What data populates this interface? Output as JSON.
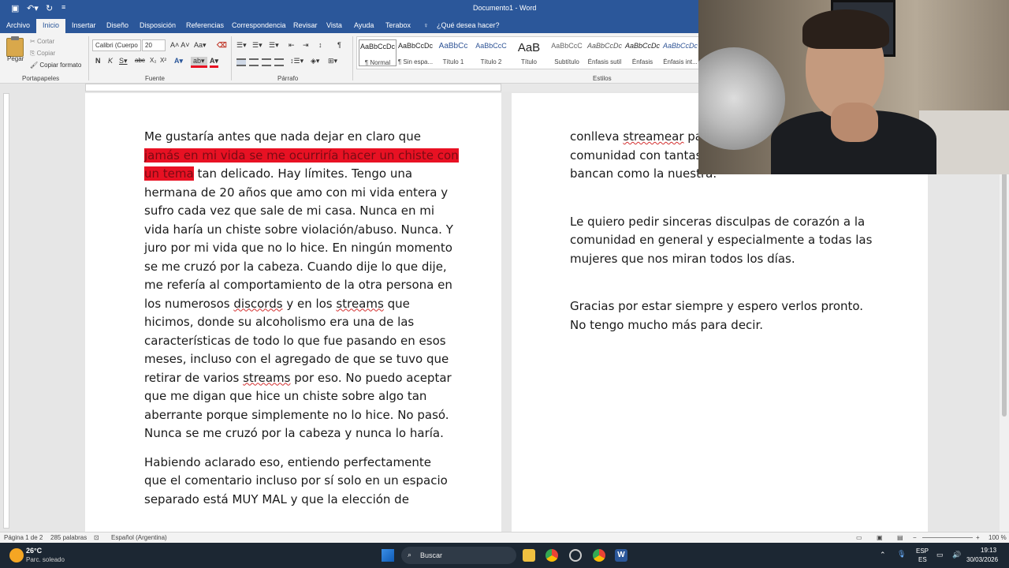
{
  "titlebar": {
    "title": "Documento1  -  Word"
  },
  "tabs": [
    {
      "label": "Archivo"
    },
    {
      "label": "Inicio"
    },
    {
      "label": "Insertar"
    },
    {
      "label": "Diseño"
    },
    {
      "label": "Disposición"
    },
    {
      "label": "Referencias"
    },
    {
      "label": "Correspondencia"
    },
    {
      "label": "Revisar"
    },
    {
      "label": "Vista"
    },
    {
      "label": "Ayuda"
    },
    {
      "label": "Terabox"
    }
  ],
  "tell_me": "¿Qué desea hacer?",
  "clipboard": {
    "paste": "Pegar",
    "cut": "Cortar",
    "copy": "Copiar",
    "format_painter": "Copiar formato",
    "group": "Portapapeles"
  },
  "font": {
    "name": "Calibri (Cuerpo",
    "size": "20",
    "group": "Fuente"
  },
  "paragraph": {
    "group": "Párrafo"
  },
  "styles": {
    "group": "Estilos",
    "items": [
      {
        "sample": "AaBbCcDc",
        "label": "¶ Normal"
      },
      {
        "sample": "AaBbCcDc",
        "label": "¶ Sin espa..."
      },
      {
        "sample": "AaBbCc",
        "label": "Título 1"
      },
      {
        "sample": "AaBbCcC",
        "label": "Título 2"
      },
      {
        "sample": "AaB",
        "label": "Título"
      },
      {
        "sample": "AaBbCcC",
        "label": "Subtítulo"
      },
      {
        "sample": "AaBbCcDc",
        "label": "Énfasis sutil"
      },
      {
        "sample": "AaBbCcDc",
        "label": "Énfasis"
      },
      {
        "sample": "AaBbCcDc",
        "label": "Énfasis int..."
      }
    ]
  },
  "doc": {
    "p1_l1": "Me gustaría antes que nada dejar en claro que",
    "p1_l2_hl": "jamás en mi vida se me ocurriría hacer un chiste con",
    "p1_l3_hl": "un tema",
    "p1_l3_rest": " tan delicado. Hay límites. Tengo una",
    "p1_l4": "hermana de 20 años que amo con mi vida entera y",
    "p1_l5": "sufro cada vez que sale de mi casa. Nunca en mi",
    "p1_l6": "vida haría un chiste sobre violación/abuso. Nunca. Y",
    "p1_l7": "juro por mi vida que no lo hice. En ningún momento",
    "p1_l8": "se me cruzó por la cabeza. Cuando dije lo que dije,",
    "p1_l9": "me refería al comportamiento de la otra persona en",
    "p1_l10_a": "los numerosos ",
    "p1_l10_sq1": "discords",
    "p1_l10_b": " y en los ",
    "p1_l10_sq2": "streams",
    "p1_l10_c": " que",
    "p1_l11": "hicimos, donde su alcoholismo era una de las",
    "p1_l12": "características de todo lo que fue pasando en esos",
    "p1_l13": "meses, incluso con el agregado de que se tuvo que",
    "p1_l14_a": "retirar de varios ",
    "p1_l14_sq": "streams",
    "p1_l14_b": " por eso. No puedo aceptar",
    "p1_l15": "que me digan que hice un chiste sobre algo tan",
    "p1_l16": "aberrante porque simplemente no lo hice. No pasó.",
    "p1_l17": "Nunca se me cruzó por la cabeza y nunca lo haría.",
    "p2_l1": "Habiendo aclarado eso, entiendo perfectamente",
    "p2_l2": "que el comentario incluso por sí solo en un espacio",
    "p2_l3": "separado está MUY MAL y que la elección de",
    "r_l1_a": "conlleva ",
    "r_l1_sq": "streamear",
    "r_l1_b": " par",
    "r_l2": "comunidad con tantas",
    "r_l3": "bancan como la nuestra.",
    "r2_l1": "Le quiero pedir sinceras disculpas de corazón a la",
    "r2_l2": "comunidad en general y especialmente a todas las",
    "r2_l3": "mujeres que nos miran todos los días.",
    "r3_l1": "Gracias por estar siempre y espero verlos pronto.",
    "r3_l2": "No tengo mucho más para decir."
  },
  "status": {
    "page": "Página 1 de 2",
    "words": "285 palabras",
    "lang": "Español (Argentina)",
    "zoom": "100 %"
  },
  "taskbar": {
    "temp": "26°C",
    "weather": "Parc. soleado",
    "search": "Buscar",
    "lang1": "ESP",
    "lang2": "ES",
    "time": "19:13",
    "date": "30/03/2026"
  }
}
